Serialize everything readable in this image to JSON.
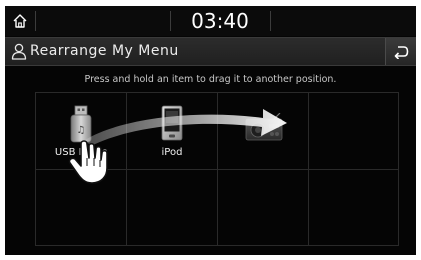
{
  "status_bar": {
    "time": "03:40",
    "home_icon": "home-icon"
  },
  "header": {
    "title": "Rearrange My Menu",
    "user_icon": "user-icon",
    "back_icon": "back-arrow-icon"
  },
  "instruction": "Press and hold an item to drag it to another position.",
  "menu_items": [
    {
      "label": "USB Music",
      "icon": "usb-music-icon"
    },
    {
      "label": "iPod",
      "icon": "ipod-icon"
    },
    {
      "label": "",
      "icon": "radio-icon"
    }
  ],
  "gesture": {
    "hand_icon": "hand-drag-icon",
    "arrow_icon": "drag-arrow-icon"
  },
  "colors": {
    "screen_background": "#050505",
    "title_bar": "#262626",
    "text": "#ececec",
    "grid_line": "#2a2a2a"
  }
}
